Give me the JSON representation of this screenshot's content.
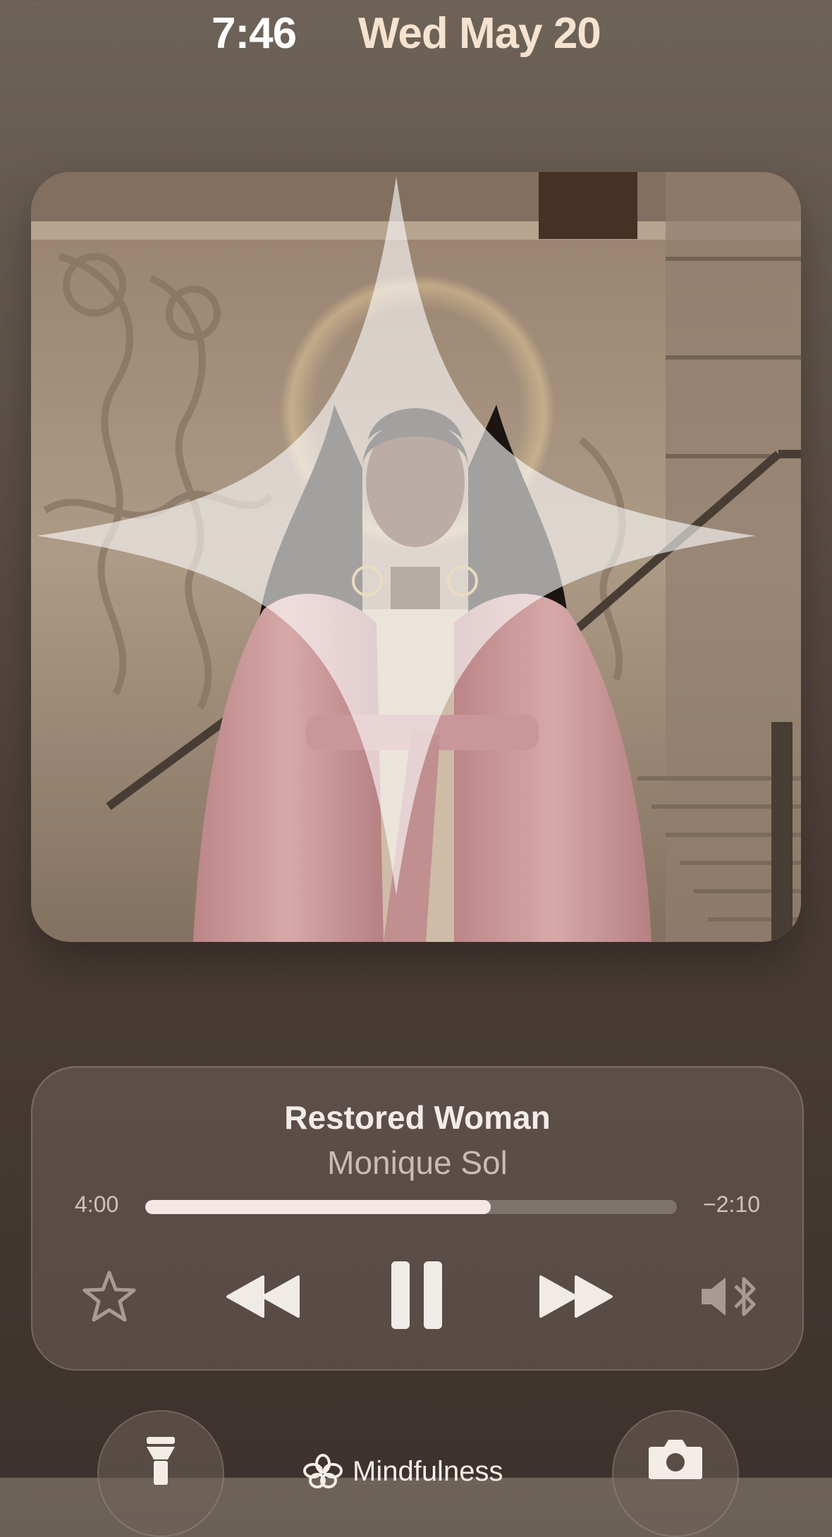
{
  "status": {
    "time": "7:46",
    "date": "Wed May 20"
  },
  "artwork": {
    "icon": "sparkle-icon",
    "colors": {
      "coat": "#e8b3b3",
      "building": "#b8a28b",
      "hair": "#1b1412",
      "skin": "#5a3423"
    }
  },
  "now_playing": {
    "title": "Restored Woman",
    "artist": "Monique Sol",
    "elapsed": "4:00",
    "remaining": "−2:10",
    "progress": 0.65,
    "controls": {
      "favorite": "star-icon",
      "previous": "rewind-icon",
      "play_pause": "pause-icon",
      "next": "fast-forward-icon",
      "output": "bluetooth-speaker-icon"
    }
  },
  "bottom": {
    "left_icon": "flashlight-icon",
    "focus_label": "Mindfulness",
    "focus_icon": "flower-icon",
    "right_icon": "camera-icon"
  }
}
